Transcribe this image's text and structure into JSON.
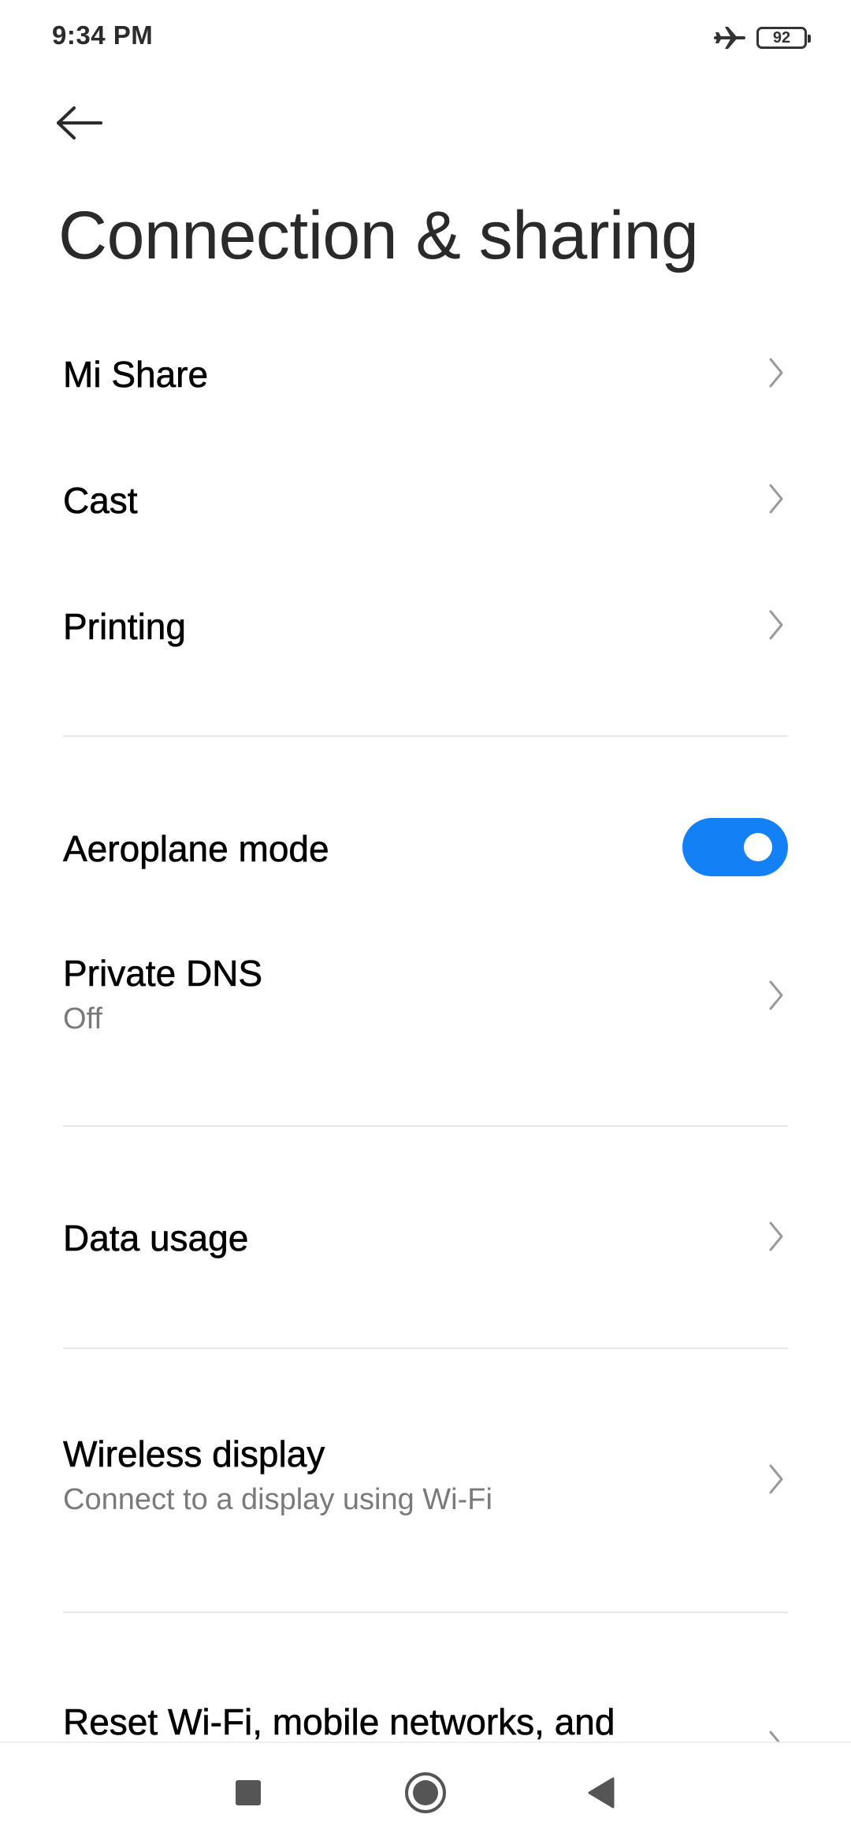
{
  "status_bar": {
    "time": "9:34 PM",
    "battery_level": "92",
    "icons": [
      "airplane-icon",
      "battery-icon"
    ]
  },
  "header": {
    "back_icon": "arrow-left-icon",
    "title": "Connection & sharing"
  },
  "items": {
    "mi_share": {
      "label": "Mi Share"
    },
    "cast": {
      "label": "Cast"
    },
    "printing": {
      "label": "Printing"
    },
    "aeroplane_mode": {
      "label": "Aeroplane mode",
      "enabled": true
    },
    "private_dns": {
      "label": "Private DNS",
      "summary": "Off"
    },
    "data_usage": {
      "label": "Data usage"
    },
    "wireless_display": {
      "label": "Wireless display",
      "summary": "Connect to a display using Wi-Fi"
    },
    "reset": {
      "label": "Reset Wi-Fi, mobile networks, and"
    }
  },
  "nav_bar": {
    "icons": [
      "recents-square-icon",
      "home-circle-icon",
      "back-triangle-icon"
    ]
  },
  "colors": {
    "accent": "#1480f5",
    "text_primary": "#000000",
    "text_secondary": "#7a7a7a",
    "chevron": "#9a9a9a",
    "divider": "#e6e6e6"
  }
}
